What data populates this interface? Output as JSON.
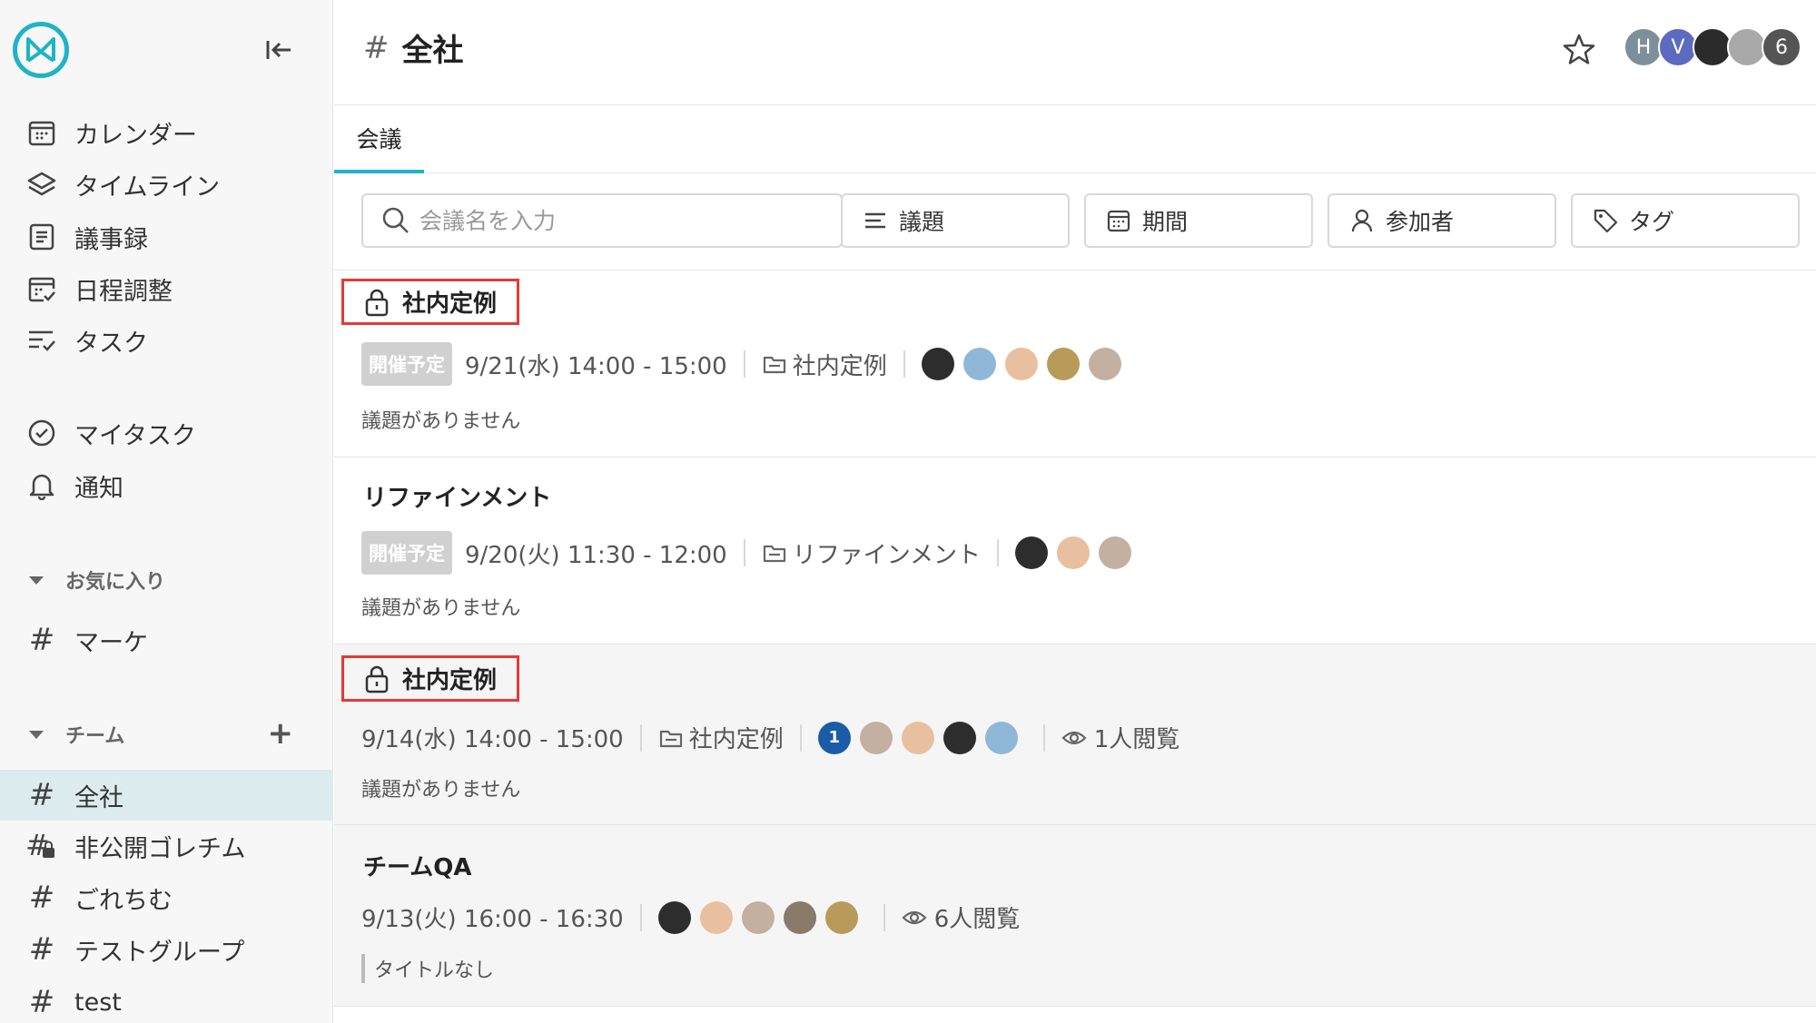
{
  "sidebar": {
    "nav": [
      {
        "label": "カレンダー",
        "icon": "calendar-icon"
      },
      {
        "label": "タイムライン",
        "icon": "layers-icon"
      },
      {
        "label": "議事録",
        "icon": "document-icon"
      },
      {
        "label": "日程調整",
        "icon": "calendar-check-icon"
      },
      {
        "label": "タスク",
        "icon": "task-list-icon"
      }
    ],
    "personal": [
      {
        "label": "マイタスク",
        "icon": "check-circle-icon"
      },
      {
        "label": "通知",
        "icon": "bell-icon"
      }
    ],
    "favorites_heading": "お気に入り",
    "favorites": [
      {
        "label": "マーケ"
      }
    ],
    "team_heading": "チーム",
    "team_add": "+",
    "teams": [
      {
        "label": "全社",
        "active": true
      },
      {
        "label": "非公開ゴレチム",
        "private": true
      },
      {
        "label": "ごれちむ"
      },
      {
        "label": "テストグループ"
      },
      {
        "label": "test"
      }
    ]
  },
  "header": {
    "hash": "#",
    "title": "全社",
    "avatars": [
      {
        "text": "H",
        "color": "#7d8f9a"
      },
      {
        "text": "V",
        "color": "#5c6bc0"
      },
      {
        "text": "",
        "color": "#2b2b2b"
      },
      {
        "text": "",
        "color": "#a9a9a9"
      },
      {
        "text": "6",
        "color": "#555555"
      }
    ]
  },
  "tabs": [
    {
      "label": "会議"
    }
  ],
  "filters": {
    "search_placeholder": "会議名を入力",
    "agenda": "議題",
    "period": "期間",
    "participants": "参加者",
    "tags": "タグ"
  },
  "meetings": [
    {
      "title": "社内定例",
      "locked": true,
      "badge": "開催予定",
      "datetime": "9/21(水) 14:00 - 15:00",
      "folder": "社内定例",
      "avatars": [
        "#2d2d2d",
        "#8fb8d8",
        "#e8c0a0",
        "#b89a5a",
        "#c4b0a0"
      ],
      "agenda": "議題がありません"
    },
    {
      "title": "リファインメント",
      "locked": false,
      "badge": "開催予定",
      "datetime": "9/20(火) 11:30 - 12:00",
      "folder": "リファインメント",
      "avatars": [
        "#2d2d2d",
        "#e8c0a0",
        "#c4b0a0"
      ],
      "agenda": "議題がありません"
    },
    {
      "title": "社内定例",
      "locked": true,
      "datetime": "9/14(水) 14:00 - 15:00",
      "folder": "社内定例",
      "count_badge": "1",
      "avatars": [
        "#c4b0a0",
        "#e8c0a0",
        "#2d2d2d",
        "#8fb8d8"
      ],
      "views": "1人閲覧",
      "agenda": "議題がありません"
    },
    {
      "title": "チームQA",
      "locked": false,
      "datetime": "9/13(火) 16:00 - 16:30",
      "avatars": [
        "#2d2d2d",
        "#e8c0a0",
        "#c4b0a0",
        "#8a7a6a",
        "#b89a5a"
      ],
      "views": "6人閲覧",
      "agenda": "タイトルなし"
    }
  ],
  "colors": {
    "accent": "#1fb3c5",
    "highlight_frame": "#e53935",
    "active_row": "#dcecee"
  }
}
